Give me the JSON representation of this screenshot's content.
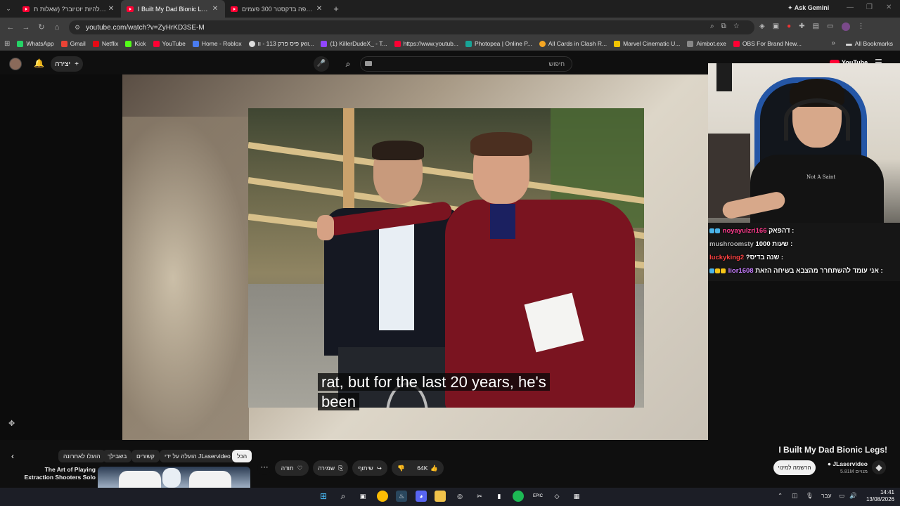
{
  "browser": {
    "tabs": [
      {
        "title": "איך זה להיות יוטיובר? (שאלות ת",
        "active": false
      },
      {
        "title": "I Built My Dad Bionic Legs! - Yo",
        "active": true
      },
      {
        "title": "הוא צפה בדקסטר 300 פעמים",
        "active": false
      }
    ],
    "ask_gemini": "Ask Gemini",
    "url": "youtube.com/watch?v=ZyHrKD3SE-M",
    "bookmarks": [
      {
        "label": "WhatsApp",
        "color": "#25d366"
      },
      {
        "label": "Gmail",
        "color": "#ea4335"
      },
      {
        "label": "Netflix",
        "color": "#e50914"
      },
      {
        "label": "Kick",
        "color": "#53fc18"
      },
      {
        "label": "YouTube",
        "color": "#ff0033"
      },
      {
        "label": "Home - Roblox",
        "color": "#4a7cf0"
      },
      {
        "label": "וואן פיס פרק 113 - וו...",
        "color": "#dddddd"
      },
      {
        "label": "(1) KillerDudeX_ - T...",
        "color": "#9146ff"
      },
      {
        "label": "https://www.youtub...",
        "color": "#ff0033"
      },
      {
        "label": "Photopea | Online P...",
        "color": "#18a497"
      },
      {
        "label": "All Cards in Clash R...",
        "color": "#f5a623"
      },
      {
        "label": "Marvel Cinematic U...",
        "color": "#f2c500"
      },
      {
        "label": "Aimbot.exe",
        "color": "#888888"
      },
      {
        "label": "OBS For Brand New...",
        "color": "#ff0033"
      }
    ],
    "all_bookmarks": "All Bookmarks"
  },
  "youtube": {
    "create_label": "יצירה",
    "search_placeholder": "חיפוש",
    "logo_text": "YouTube"
  },
  "video": {
    "caption_line1": "rat, but for the last 20 years, he's",
    "caption_line2": "been",
    "title": "I Built My Dad Bionic Legs!",
    "channel": "JLaservideo",
    "subscribers": "5.81M מנויים",
    "subscribe_label": "הרשמה למינוי",
    "likes": "64K",
    "share_label": "שיתוף",
    "save_label": "שמירה",
    "thanks_label": "תודה"
  },
  "stream": {
    "shirt_text": "Not A Saint",
    "chat": [
      {
        "user": "noyayulzri166",
        "user_color": "#ff3b8d",
        "msg": "דהפאק :"
      },
      {
        "user": "mushroomsty",
        "user_color": "#b8b8b8",
        "msg": "1000 שעות :"
      },
      {
        "user": "luckyking2",
        "user_color": "#ff4040",
        "msg": "?שנה בדיס :"
      },
      {
        "user": "lior1608",
        "user_color": "#c77dff",
        "msg": "אני עומד להשתחרר מהצבא בשיחה הזאת :"
      }
    ]
  },
  "chips": [
    {
      "label": "הכל",
      "active": true
    },
    {
      "label": "הועלה על ידי JLaservideo",
      "active": false
    },
    {
      "label": "קשורים",
      "active": false
    },
    {
      "label": "בשבילך",
      "active": false
    },
    {
      "label": "הועלו לאחרונה",
      "active": false
    }
  ],
  "recommended": {
    "title": "The Art of Playing Extraction Shooters Solo"
  },
  "taskbar": {
    "lang": "עבר",
    "time": "14:41",
    "date": "13/08/2026"
  }
}
